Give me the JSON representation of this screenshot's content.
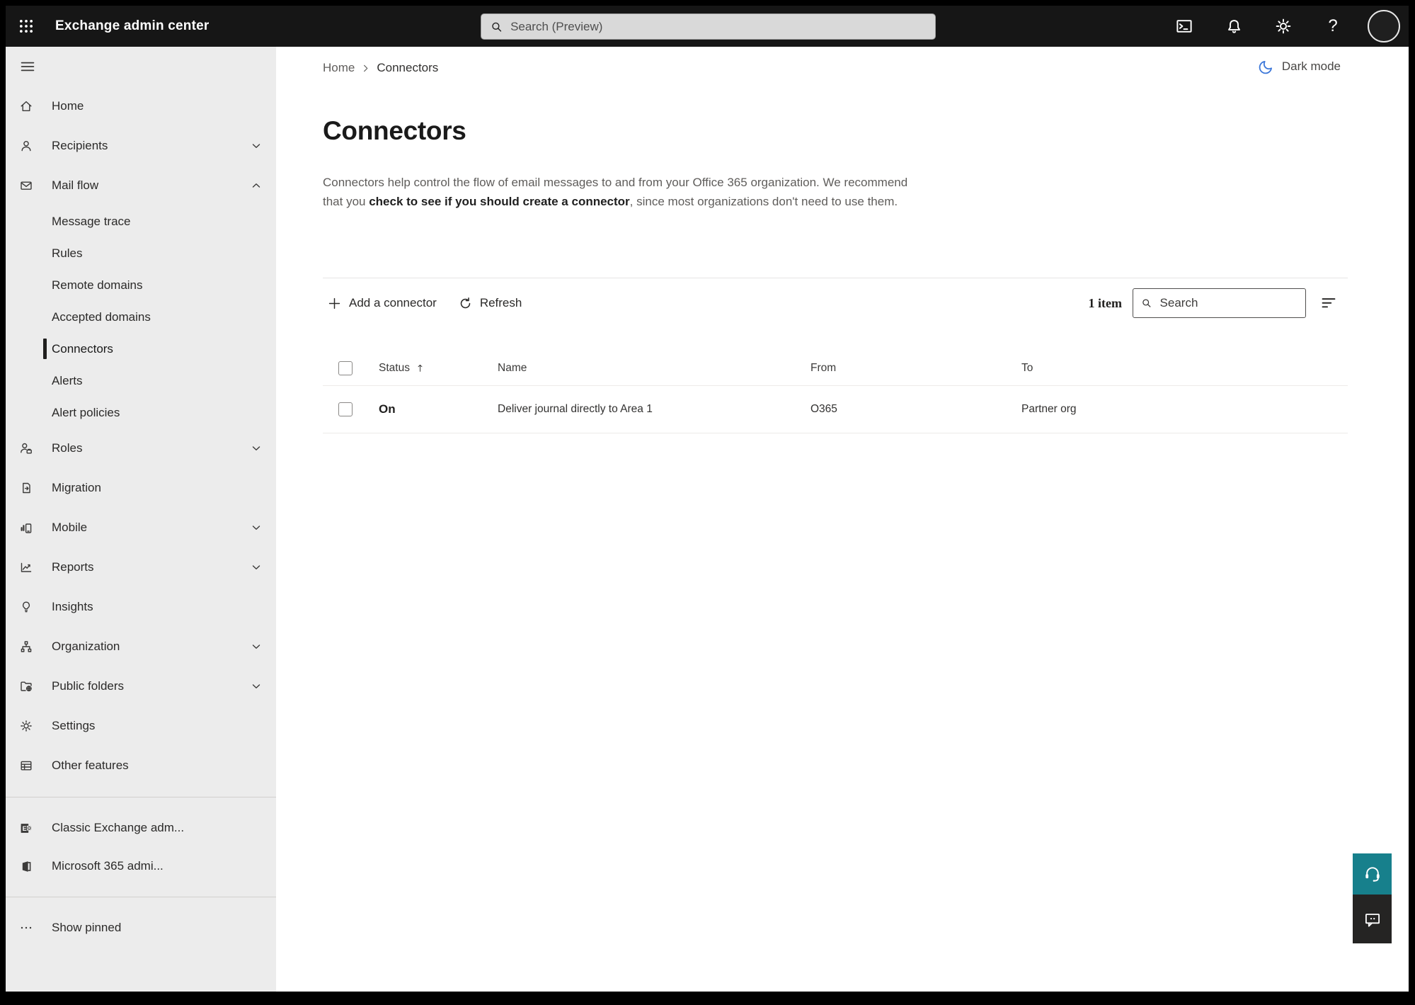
{
  "topbar": {
    "app_title": "Exchange admin center",
    "search_placeholder": "Search (Preview)"
  },
  "breadcrumb": {
    "home": "Home",
    "current": "Connectors"
  },
  "dark_mode": {
    "label": "Dark mode"
  },
  "page": {
    "title": "Connectors",
    "description_prefix": "Connectors help control the flow of email messages to and from your Office 365 organization. We recommend that you ",
    "description_link": "check to see if you should create a connector",
    "description_suffix": ", since most organizations don't need to use them."
  },
  "toolbar": {
    "add_connector": "Add a connector",
    "refresh": "Refresh",
    "item_count": "1 item",
    "search_placeholder": "Search"
  },
  "table": {
    "headers": {
      "status": "Status",
      "name": "Name",
      "from": "From",
      "to": "To"
    },
    "rows": [
      {
        "status": "On",
        "name": "Deliver journal directly to Area 1",
        "from": "O365",
        "to": "Partner org"
      }
    ]
  },
  "sidebar": {
    "items": [
      {
        "label": "Home"
      },
      {
        "label": "Recipients"
      },
      {
        "label": "Mail flow"
      },
      {
        "label": "Message trace"
      },
      {
        "label": "Rules"
      },
      {
        "label": "Remote domains"
      },
      {
        "label": "Accepted domains"
      },
      {
        "label": "Connectors"
      },
      {
        "label": "Alerts"
      },
      {
        "label": "Alert policies"
      },
      {
        "label": "Roles"
      },
      {
        "label": "Migration"
      },
      {
        "label": "Mobile"
      },
      {
        "label": "Reports"
      },
      {
        "label": "Insights"
      },
      {
        "label": "Organization"
      },
      {
        "label": "Public folders"
      },
      {
        "label": "Settings"
      },
      {
        "label": "Other features"
      },
      {
        "label": "Classic Exchange adm..."
      },
      {
        "label": "Microsoft 365 admi..."
      },
      {
        "label": "Show pinned"
      }
    ]
  },
  "colors": {
    "topbar_bg": "#161616",
    "sidebar_bg": "#ececec",
    "accent_teal": "#17808c",
    "feedback_bg": "#252423",
    "moon_blue": "#3c77d9",
    "selected_marker": "#201f1e"
  },
  "icons": [
    "app-launcher-icon",
    "search-icon",
    "terminal-icon",
    "bell-icon",
    "gear-icon",
    "help-icon",
    "avatar",
    "hamburger-icon",
    "home-icon",
    "person-icon",
    "mail-icon",
    "roles-icon",
    "migration-icon",
    "mobile-icon",
    "reports-icon",
    "insights-icon",
    "organization-icon",
    "public-folders-icon",
    "settings-icon",
    "other-features-icon",
    "classic-exchange-icon",
    "microsoft-365-icon",
    "more-dots-icon",
    "chevron-down-icon",
    "chevron-up-icon",
    "moon-icon",
    "plus-icon",
    "refresh-icon",
    "filter-icon",
    "sort-ascending-icon",
    "headset-icon",
    "feedback-bubble-icon"
  ]
}
